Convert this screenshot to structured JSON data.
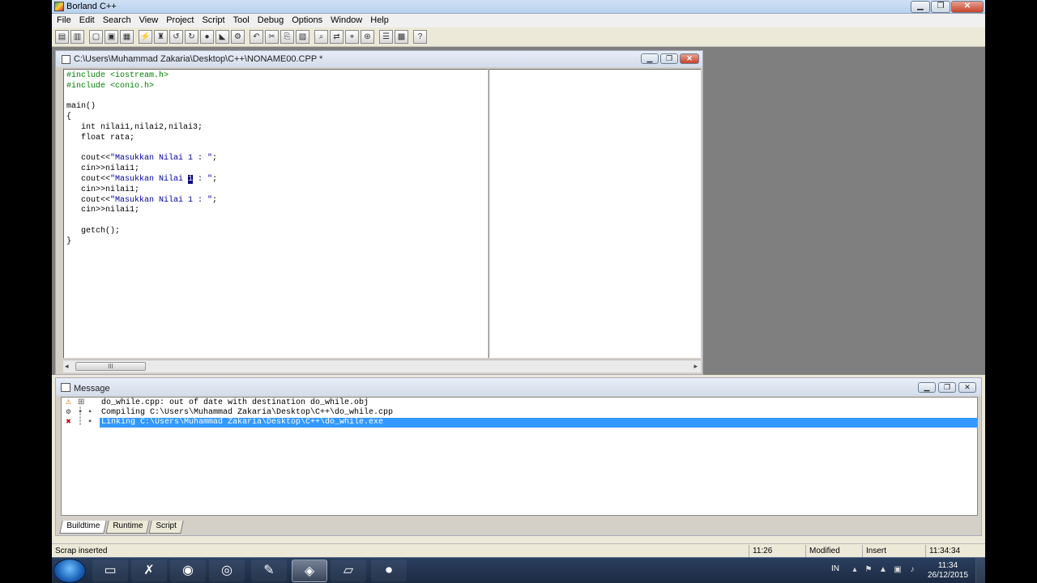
{
  "window": {
    "title": "Borland C++"
  },
  "menu": [
    "File",
    "Edit",
    "Search",
    "View",
    "Project",
    "Script",
    "Tool",
    "Debug",
    "Options",
    "Window",
    "Help"
  ],
  "editor": {
    "title": "C:\\Users\\Muhammad Zakaria\\Desktop\\C++\\NONAME00.CPP *",
    "code": {
      "l1_pp": "#include <iostream.h>",
      "l2_pp": "#include <conio.h>",
      "l4": "main()",
      "l5": "{",
      "l6": "   int nilai1,nilai2,nilai3;",
      "l7": "   float rata;",
      "l9_a": "   cout<<",
      "l9_s": "\"Masukkan Nilai 1 : \"",
      "l9_b": ";",
      "l10": "   cin>>nilai1;",
      "l11_a": "   cout<<",
      "l11_s1": "\"Masukkan Nilai ",
      "l11_caret": "1",
      "l11_s2": " : \"",
      "l11_b": ";",
      "l12": "   cin>>nilai1;",
      "l13_a": "   cout<<",
      "l13_s": "\"Masukkan Nilai 1 : \"",
      "l13_b": ";",
      "l14": "   cin>>nilai1;",
      "l16": "   getch();",
      "l17": "}"
    },
    "scroll_thumb": "III"
  },
  "message": {
    "title": "Message",
    "rows": [
      {
        "text": "do_while.cpp: out of date with destination do_while.obj",
        "tree": "⊞ ▪"
      },
      {
        "text": "Compiling C:\\Users\\Muhammad Zakaria\\Desktop\\C++\\do_while.cpp",
        "tree": "┆ ▪"
      },
      {
        "text": "Linking C:\\Users\\Muhammad Zakaria\\Desktop\\C++\\do_while.exe",
        "tree": "┆ ▪"
      }
    ],
    "tabs": [
      "Buildtime",
      "Runtime",
      "Script"
    ]
  },
  "status": {
    "message": "Scrap inserted",
    "position": "11:26",
    "modified": "Modified",
    "mode": "Insert",
    "time": "11:34:34"
  },
  "taskbar": {
    "lang": "IN",
    "clock_time": "11:34",
    "clock_date": "26/12/2015"
  }
}
